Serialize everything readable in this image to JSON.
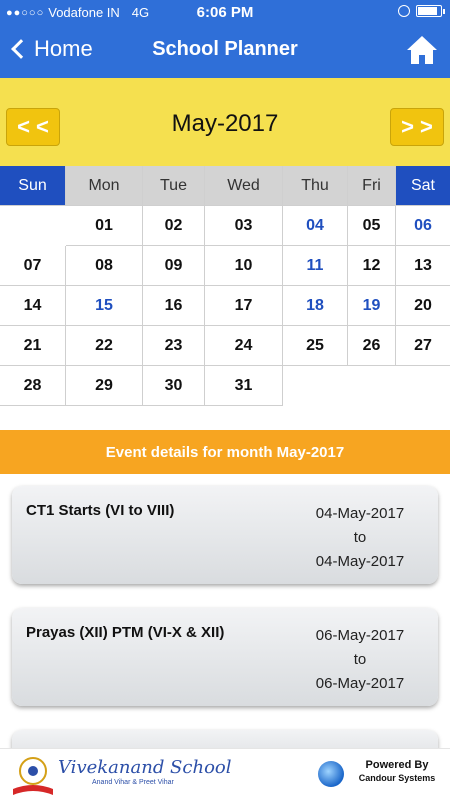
{
  "status": {
    "carrier": "Vodafone IN",
    "network": "4G",
    "time": "6:06 PM",
    "signal_dots": "●●○○○"
  },
  "nav": {
    "back_label": "Home",
    "title": "School Planner"
  },
  "month": {
    "prev_label": "< <",
    "next_label": "> >",
    "label": "May-2017"
  },
  "calendar": {
    "weekdays": [
      "Sun",
      "Mon",
      "Tue",
      "Wed",
      "Thu",
      "Fri",
      "Sat"
    ],
    "weeks": [
      [
        "",
        "01",
        "02",
        "03",
        "04",
        "05",
        "06"
      ],
      [
        "07",
        "08",
        "09",
        "10",
        "11",
        "12",
        "13"
      ],
      [
        "14",
        "15",
        "16",
        "17",
        "18",
        "19",
        "20"
      ],
      [
        "21",
        "22",
        "23",
        "24",
        "25",
        "26",
        "27"
      ],
      [
        "28",
        "29",
        "30",
        "31",
        "",
        "",
        ""
      ]
    ],
    "highlighted": [
      "04",
      "06",
      "11",
      "15",
      "18",
      "19"
    ],
    "colors": {
      "weekend_header": "#1f4fbf",
      "event_date": "#1f4fbf",
      "header_bg": "#2f6fd8",
      "month_bar": "#f5e04f",
      "events_bar": "#f7a521"
    }
  },
  "events": {
    "heading": "Event details for month May-2017",
    "items": [
      {
        "title": "CT1 Starts (VI to VIII)",
        "from": "04-May-2017",
        "to_word": "to",
        "to": "04-May-2017"
      },
      {
        "title": "Prayas (XII) PTM (VI-X & XII)",
        "from": "06-May-2017",
        "to_word": "to",
        "to": "06-May-2017"
      }
    ]
  },
  "footer": {
    "school_name": "Vivekanand School",
    "school_sub": "Anand Vihar & Preet Vihar",
    "powered_by": "Powered By",
    "company": "Candour Systems"
  }
}
